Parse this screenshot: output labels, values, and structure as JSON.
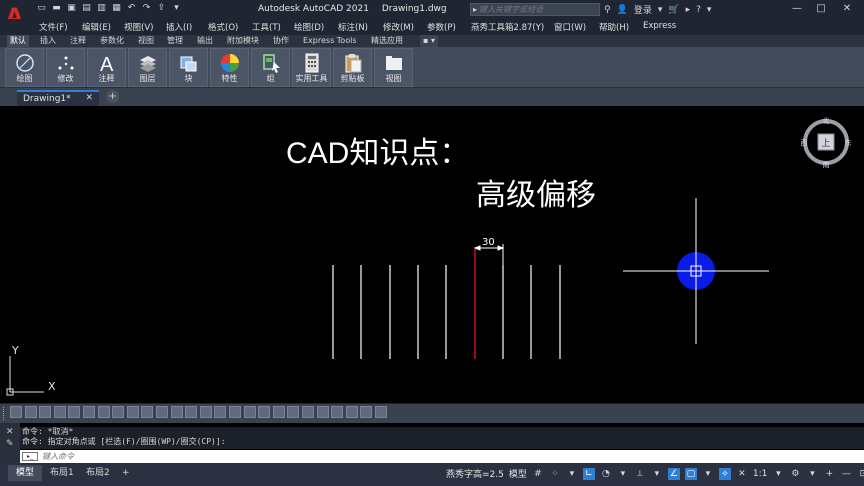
{
  "app": {
    "logo_letter": "A",
    "title": "Autodesk AutoCAD 2021",
    "filename": "Drawing1.dwg"
  },
  "quick_access": [
    "new-icon",
    "open-icon",
    "save-icon",
    "saveas-icon",
    "print-icon",
    "plot-icon",
    "undo-icon",
    "redo-icon",
    "share-icon",
    "more-icon"
  ],
  "search": {
    "placeholder": "键入关键字或短语"
  },
  "user": {
    "login_label": "登录"
  },
  "menus": [
    "文件(F)",
    "编辑(E)",
    "视图(V)",
    "插入(I)",
    "格式(O)",
    "工具(T)",
    "绘图(D)",
    "标注(N)",
    "修改(M)",
    "参数(P)",
    "燕秀工具箱2.87(Y)",
    "窗口(W)",
    "帮助(H)",
    "Express"
  ],
  "ribbon_tabs": [
    "默认",
    "插入",
    "注释",
    "参数化",
    "视图",
    "管理",
    "输出",
    "附加模块",
    "协作",
    "Express Tools",
    "精选应用"
  ],
  "ribbon_buttons": [
    "绘图",
    "修改",
    "注释",
    "图层",
    "块",
    "特性",
    "组",
    "实用工具",
    "剪贴板",
    "视图"
  ],
  "document_tab": {
    "label": "Drawing1*"
  },
  "canvas": {
    "heading": "CAD知识点：",
    "subheading": "高级偏移",
    "dimension": "30",
    "ucs_y": "Y",
    "ucs_x": "X"
  },
  "viewcube": {
    "north": "北",
    "south": "南",
    "east": "东",
    "west": "西",
    "face": "上"
  },
  "command": {
    "history_1": "命令: *取消*",
    "history_2": "命令: 指定对角点或 [栏选(F)/圈围(WP)/圈交(CP)]:",
    "placeholder": "键入命令"
  },
  "layout_tabs": [
    "模型",
    "布局1",
    "布局2"
  ],
  "status": {
    "font_height": "燕秀字高=2.5",
    "mode": "模型",
    "scale": "1:1"
  }
}
